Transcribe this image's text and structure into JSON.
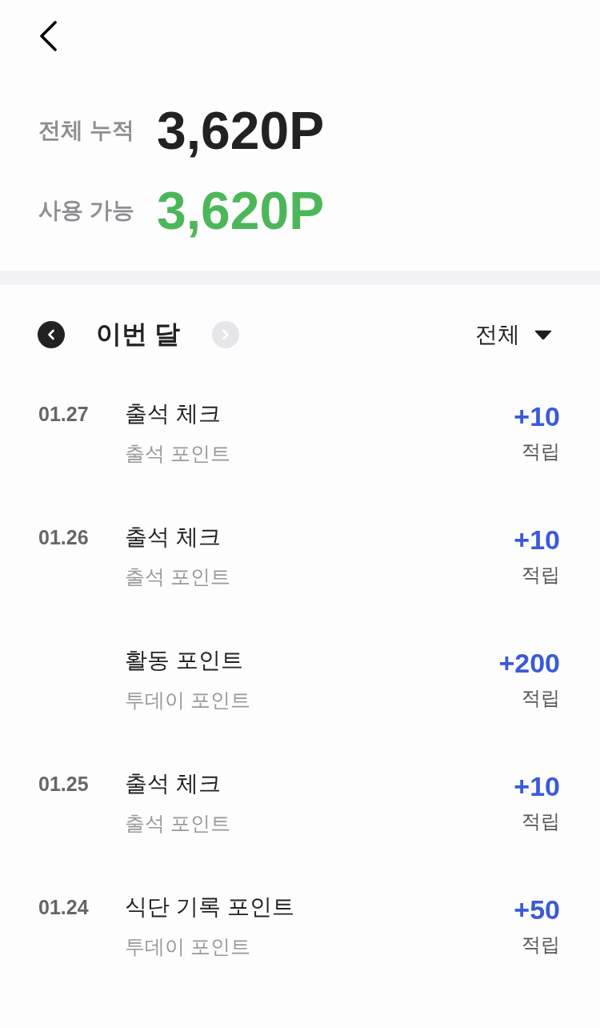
{
  "summary": [
    {
      "kind": "total",
      "label": "전체 누적",
      "value": "3,620P"
    },
    {
      "kind": "available",
      "label": "사용 가능",
      "value": "3,620P"
    }
  ],
  "month_nav": {
    "prev": {
      "disabled": false
    },
    "label": "이번 달",
    "next": {
      "disabled": true
    }
  },
  "filter": {
    "label": "전체"
  },
  "entries": [
    {
      "date": "01.27",
      "title": "출석 체크",
      "subtitle": "출석 포인트",
      "amount": "+10",
      "status": "적립"
    },
    {
      "date": "01.26",
      "title": "출석 체크",
      "subtitle": "출석 포인트",
      "amount": "+10",
      "status": "적립"
    },
    {
      "title": "활동 포인트",
      "subtitle": "투데이 포인트",
      "amount": "+200",
      "status": "적립"
    },
    {
      "date": "01.25",
      "title": "출석 체크",
      "subtitle": "출석 포인트",
      "amount": "+10",
      "status": "적립"
    },
    {
      "date": "01.24",
      "title": "식단 기록 포인트",
      "subtitle": "투데이 포인트",
      "amount": "+50",
      "status": "적립"
    }
  ]
}
